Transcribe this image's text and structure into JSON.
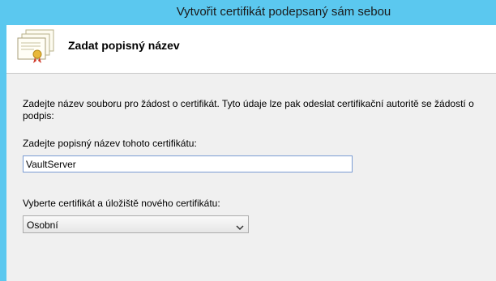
{
  "window": {
    "title": "Vytvořit certifikát podepsaný sám sebou"
  },
  "header": {
    "heading": "Zadat popisný název",
    "icon": "certificate-wizard-icon"
  },
  "content": {
    "description": "Zadejte název souboru pro žádost o certifikát. Tyto údaje lze pak odeslat certifikační autoritě se žádostí o podpis:",
    "friendly_name_label": "Zadejte popisný název tohoto certifikátu:",
    "friendly_name_value": "VaultServer",
    "store_label": "Vyberte certifikát a úložiště nového certifikátu:",
    "store_selected": "Osobní"
  }
}
